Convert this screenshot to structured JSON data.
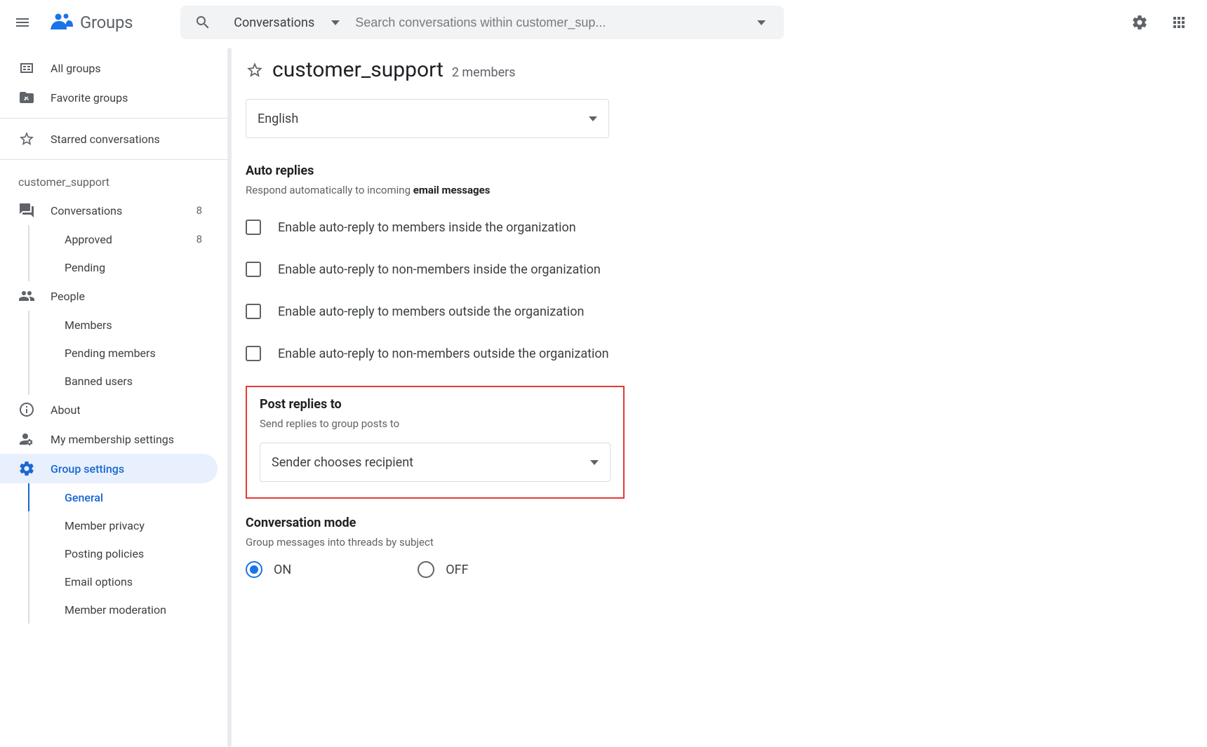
{
  "header": {
    "product": "Groups",
    "search_scope": "Conversations",
    "search_placeholder": "Search conversations within customer_sup..."
  },
  "sidebar": {
    "top": [
      {
        "label": "All groups"
      },
      {
        "label": "Favorite groups"
      }
    ],
    "starred": "Starred conversations",
    "group_name": "customer_support",
    "conversations": {
      "label": "Conversations",
      "count": "8"
    },
    "conv_children": [
      {
        "label": "Approved",
        "count": "8"
      },
      {
        "label": "Pending"
      }
    ],
    "people": {
      "label": "People"
    },
    "people_children": [
      {
        "label": "Members"
      },
      {
        "label": "Pending members"
      },
      {
        "label": "Banned users"
      }
    ],
    "about": {
      "label": "About"
    },
    "membership": {
      "label": "My membership settings"
    },
    "settings": {
      "label": "Group settings"
    },
    "settings_children": [
      {
        "label": "General"
      },
      {
        "label": "Member privacy"
      },
      {
        "label": "Posting policies"
      },
      {
        "label": "Email options"
      },
      {
        "label": "Member moderation"
      }
    ]
  },
  "main": {
    "group_title": "customer_support",
    "member_count": "2 members",
    "language_select": "English",
    "auto_replies": {
      "title": "Auto replies",
      "subtitle_prefix": "Respond automatically to incoming ",
      "subtitle_bold": "email messages",
      "options": [
        "Enable auto-reply to members inside the organization",
        "Enable auto-reply to non-members inside the organization",
        "Enable auto-reply to members outside the organization",
        "Enable auto-reply to non-members outside the organization"
      ]
    },
    "post_replies": {
      "title": "Post replies to",
      "subtitle": "Send replies to group posts to",
      "selected": "Sender chooses recipient"
    },
    "conversation_mode": {
      "title": "Conversation mode",
      "subtitle": "Group messages into threads by subject",
      "on": "ON",
      "off": "OFF"
    }
  }
}
